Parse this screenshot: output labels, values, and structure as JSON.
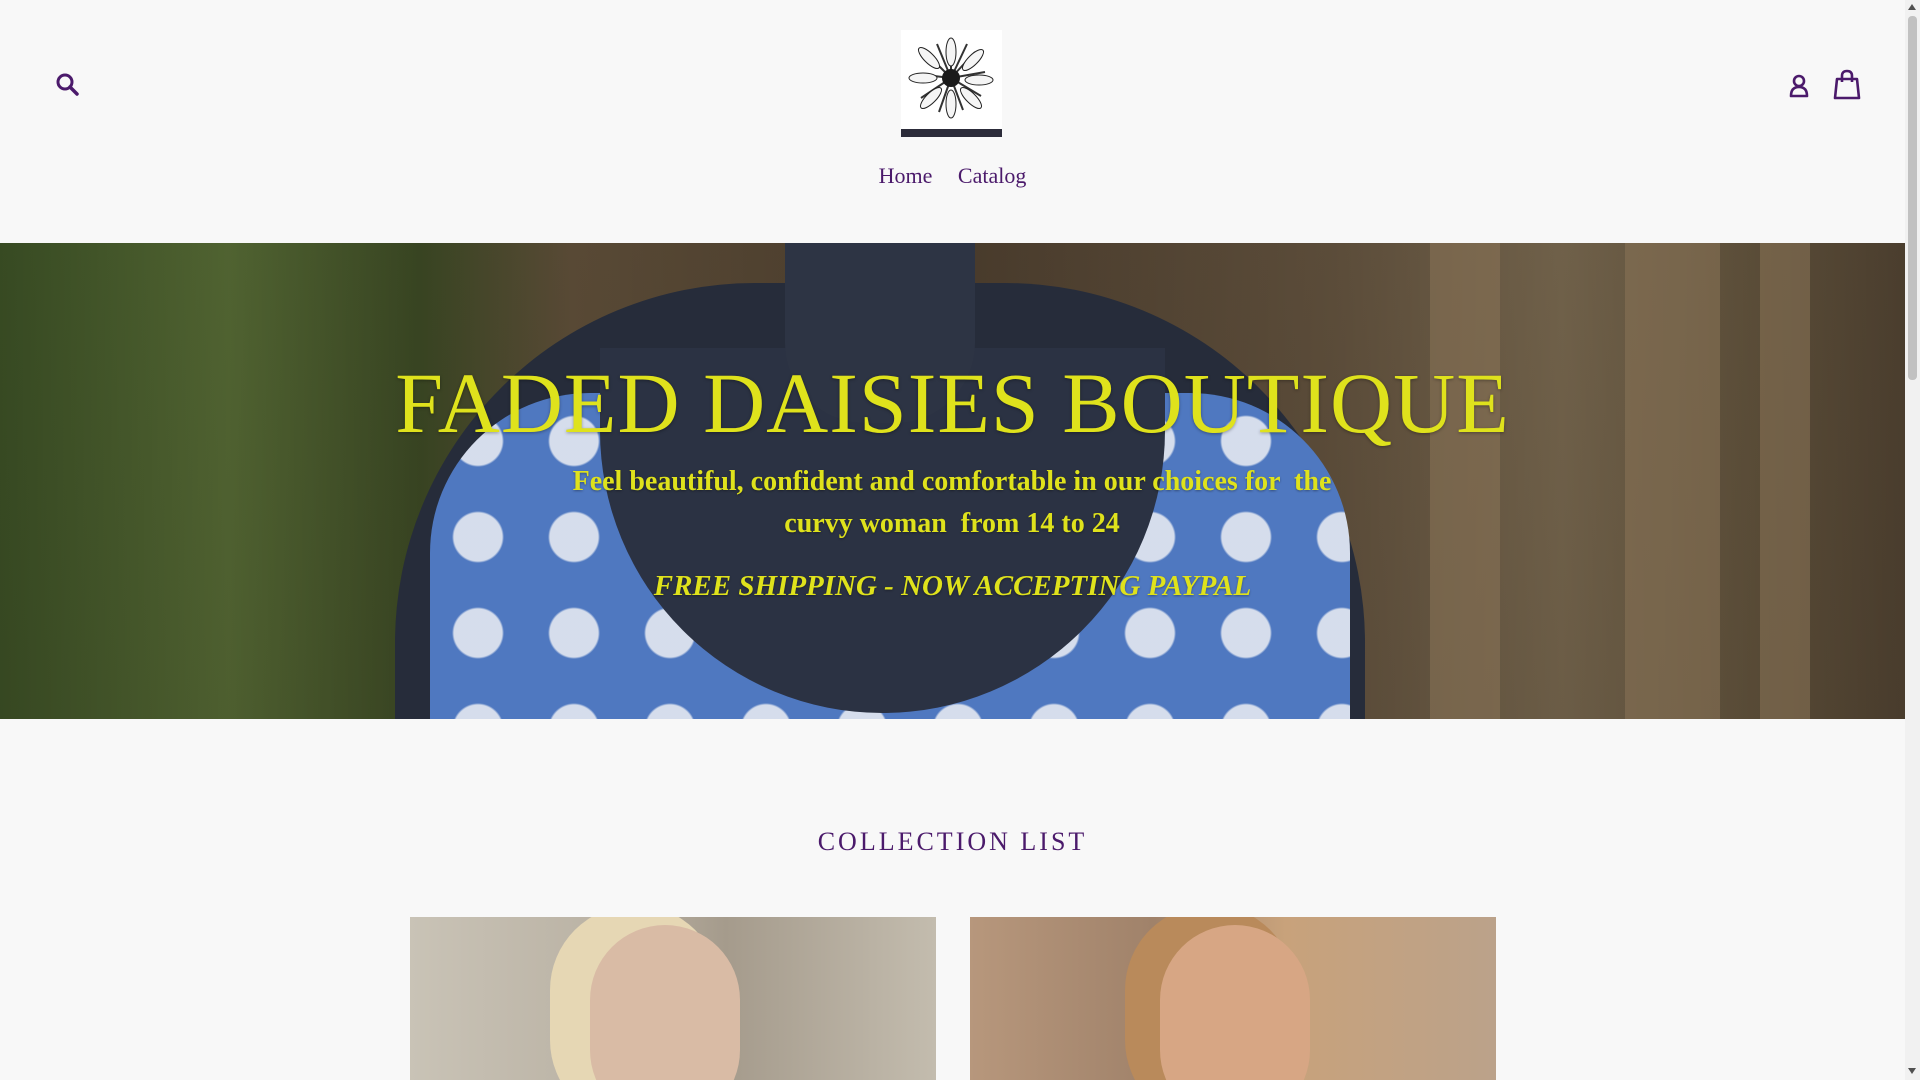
{
  "header": {
    "search_icon": "search-icon",
    "logo_icon": "daisy-logo",
    "account_icon": "account-icon",
    "cart_icon": "cart-icon",
    "nav": [
      {
        "label": "Home"
      },
      {
        "label": "Catalog"
      }
    ]
  },
  "hero": {
    "title": "FADED DAISIES BOUTIQUE",
    "subtitle": "Feel beautiful, confident and comfortable in our choices for  the curvy woman  from 14 to 24",
    "shipping": "FREE SHIPPING - NOW ACCEPTING PAYPAL"
  },
  "collections": {
    "title": "COLLECTION LIST"
  },
  "colors": {
    "accent": "#4b1a6b",
    "hero_text": "#dfe21c",
    "background": "#f8f8f8"
  }
}
